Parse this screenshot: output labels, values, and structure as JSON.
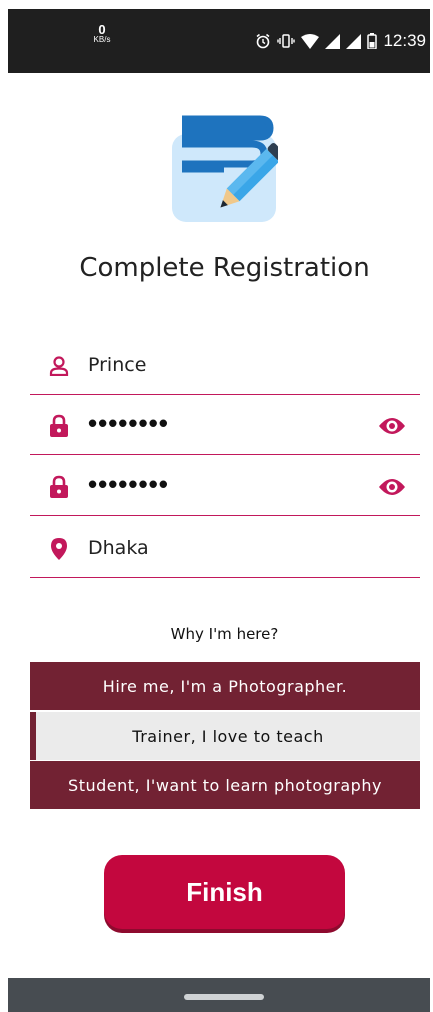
{
  "status_bar": {
    "net_speed_value": "0",
    "net_speed_unit": "KB/s",
    "time": "12:39",
    "icons": [
      "alarm-icon",
      "vibrate-icon",
      "wifi-icon",
      "signal-icon",
      "signal-icon",
      "battery-icon"
    ]
  },
  "header": {
    "logo_icon": "registration-form-pencil-icon",
    "title": "Complete Registration"
  },
  "form": {
    "name": {
      "icon": "person-icon",
      "value": "Prince"
    },
    "password": {
      "icon": "lock-icon",
      "value": "••••••••",
      "toggle_icon": "eye-icon"
    },
    "confirm_password": {
      "icon": "lock-icon",
      "value": "••••••••",
      "toggle_icon": "eye-icon"
    },
    "location": {
      "icon": "location-pin-icon",
      "value": "Dhaka"
    }
  },
  "purpose": {
    "question": "Why I'm here?",
    "options": [
      {
        "label": "Hire me, I'm a Photographer.",
        "selected": false
      },
      {
        "label": "Trainer, I love to teach",
        "selected": true
      },
      {
        "label": "Student, I'want to learn photography",
        "selected": false
      }
    ]
  },
  "finish_label": "Finish",
  "colors": {
    "accent": "#c2185b",
    "option_dark": "#722233",
    "finish_button": "#c3073e"
  }
}
